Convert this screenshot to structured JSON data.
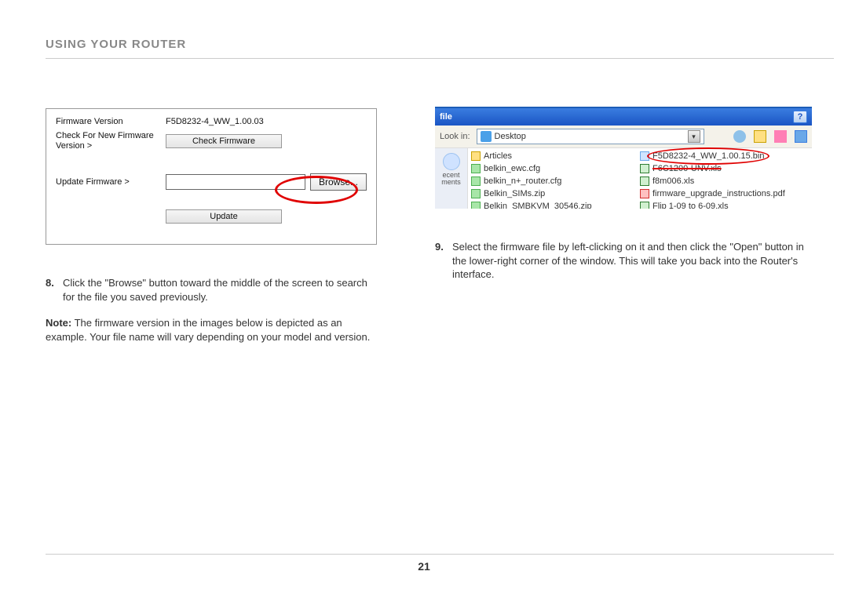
{
  "page": {
    "title": "USING YOUR ROUTER",
    "number": "21"
  },
  "router_ui": {
    "firmware_label": "Firmware Version",
    "firmware_value": "F5D8232-4_WW_1.00.03",
    "check_label": "Check For New Firmware Version >",
    "check_button": "Check Firmware",
    "update_label": "Update Firmware >",
    "browse_button": "Browse...",
    "update_button": "Update"
  },
  "left_instructions": {
    "step_num": "8.",
    "step_text": "Click the \"Browse\" button toward the middle of the screen to search for the file you saved previously.",
    "note_label": "Note:",
    "note_text": " The firmware version in the images below is depicted as an example. Your file name will vary depending on your model and version."
  },
  "file_dialog": {
    "title": "file",
    "lookin_label": "Look in:",
    "lookin_value": "Desktop",
    "places_label": "ecent ments",
    "col1": [
      {
        "icon": "folder",
        "name": "Articles"
      },
      {
        "icon": "cfg",
        "name": "belkin_ewc.cfg"
      },
      {
        "icon": "cfg",
        "name": "belkin_n+_router.cfg"
      },
      {
        "icon": "zip",
        "name": "Belkin_SIMs.zip"
      },
      {
        "icon": "zip",
        "name": "Belkin_SMBKVM_30546.zip"
      }
    ],
    "col2": [
      {
        "icon": "bin",
        "name": "F5D8232-4_WW_1.00.15.bin"
      },
      {
        "icon": "xls",
        "name": "F6C1200-UNV.xls",
        "strike": true
      },
      {
        "icon": "xls",
        "name": "f8m006.xls"
      },
      {
        "icon": "pdf",
        "name": "firmware_upgrade_instructions.pdf"
      },
      {
        "icon": "xls",
        "name": "Flip 1-09 to 6-09.xls"
      }
    ]
  },
  "right_instructions": {
    "step_num": "9.",
    "step_text": "Select the firmware file by left-clicking on it and then click the \"Open\" button in the lower-right corner of the window. This will take you back into the Router's interface."
  }
}
